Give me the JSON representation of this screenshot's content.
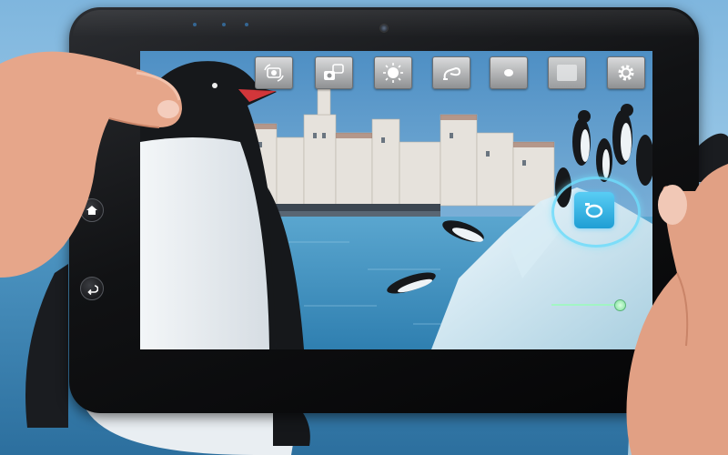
{
  "camera_app": {
    "toolbar": [
      {
        "name": "switch-camera-icon"
      },
      {
        "name": "effects-icon"
      },
      {
        "name": "exposure-icon"
      },
      {
        "name": "flash-icon"
      },
      {
        "name": "focus-mode-icon"
      },
      {
        "name": "white-balance-icon"
      },
      {
        "name": "settings-gear-icon"
      }
    ],
    "shutter": {
      "icon": "camera-icon"
    },
    "zoom": {
      "level": 0.9
    }
  },
  "device": {
    "buttons": [
      {
        "name": "home-icon"
      },
      {
        "name": "back-icon"
      }
    ]
  },
  "colors": {
    "bezel": "#111214",
    "shutter_accent": "#2eb6e8",
    "zoom_accent": "#7de09a",
    "toolbar_button": "#b8babc"
  }
}
